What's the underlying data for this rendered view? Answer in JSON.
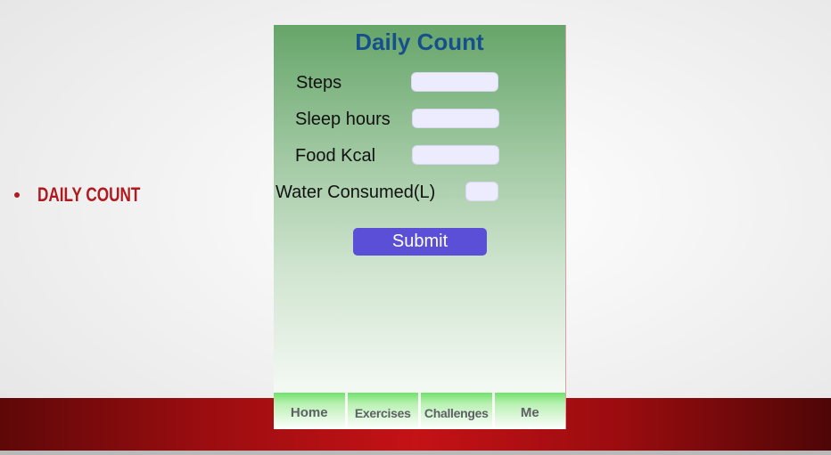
{
  "slide": {
    "bullet_label": "DAILY COUNT"
  },
  "app": {
    "title": "Daily Count",
    "fields": [
      {
        "label": "Steps",
        "value": ""
      },
      {
        "label": "Sleep hours",
        "value": ""
      },
      {
        "label": "Food Kcal",
        "value": ""
      },
      {
        "label": "Water Consumed(L)",
        "value": ""
      }
    ],
    "submit_label": "Submit",
    "nav": [
      {
        "label": "Home"
      },
      {
        "label": "Exercises"
      },
      {
        "label": "Challenges"
      },
      {
        "label": "Me"
      }
    ]
  },
  "colors": {
    "title": "#16508c",
    "submit": "#5a4fd6",
    "bullet": "#b0191e",
    "slide_bar": "#c41216"
  }
}
